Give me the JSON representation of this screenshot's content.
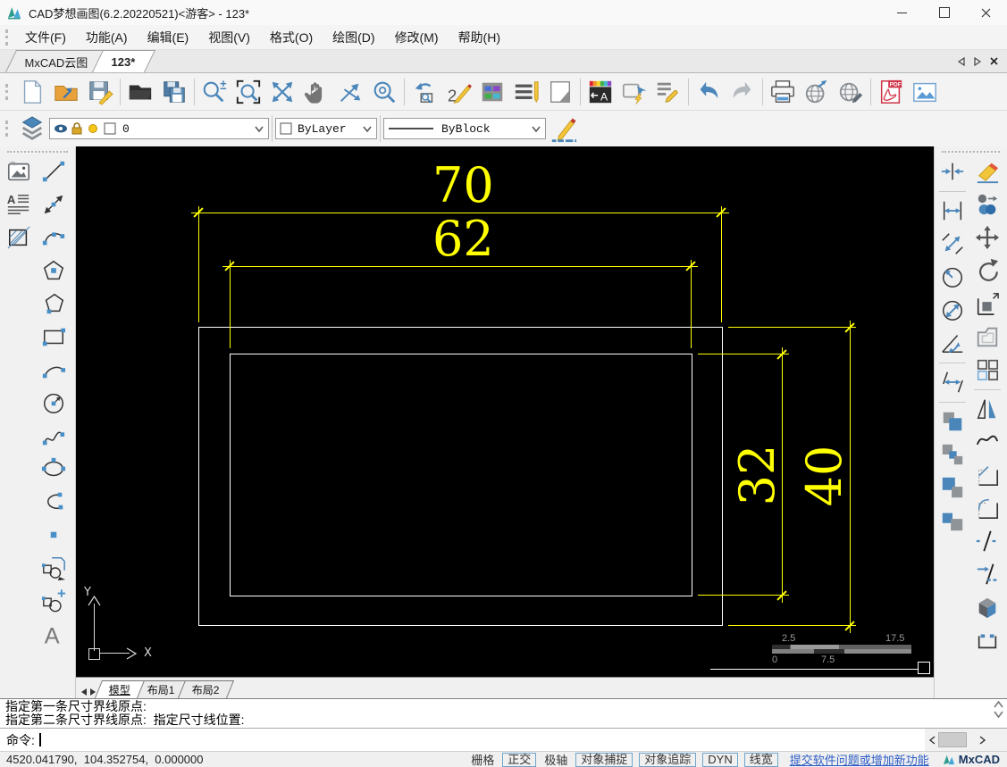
{
  "window": {
    "title": "CAD梦想画图(6.2.20220521)<游客> - 123*"
  },
  "menu": {
    "items": [
      {
        "label": "文件(F)"
      },
      {
        "label": "功能(A)"
      },
      {
        "label": "编辑(E)"
      },
      {
        "label": "视图(V)"
      },
      {
        "label": "格式(O)"
      },
      {
        "label": "绘图(D)"
      },
      {
        "label": "修改(M)"
      },
      {
        "label": "帮助(H)"
      }
    ]
  },
  "doc_tabs": {
    "tabs": [
      {
        "label": "MxCAD云图"
      },
      {
        "label": "123*"
      }
    ]
  },
  "layer_bar": {
    "layer_name": "0",
    "color_name": "ByLayer",
    "linetype_name": "ByBlock"
  },
  "canvas": {
    "dim_top_outer": "70",
    "dim_top_inner": "62",
    "dim_right_inner": "32",
    "dim_right_outer": "40",
    "ucs_x": "X",
    "ucs_y": "Y",
    "scale_top_left": "2.5",
    "scale_top_right": "17.5",
    "scale_bottom_left": "0",
    "scale_bottom_mid": "7.5"
  },
  "colors": {
    "dimension_yellow": "#ffff00",
    "drawing_white": "#ffffff",
    "canvas_black": "#000000",
    "accent_blue": "#4a86ba"
  },
  "layout_tabs": {
    "tabs": [
      {
        "label": "模型"
      },
      {
        "label": "布局1"
      },
      {
        "label": "布局2"
      }
    ]
  },
  "command": {
    "history_line_1": "指定第一条尺寸界线原点:",
    "history_line_2": "指定第二条尺寸界线原点:  指定尺寸线位置:",
    "prompt": "命令:"
  },
  "status": {
    "coordinates": "4520.041790,  104.352754,  0.000000",
    "toggles": [
      {
        "label": "栅格",
        "active": false
      },
      {
        "label": "正交",
        "active": true
      },
      {
        "label": "极轴",
        "active": false
      },
      {
        "label": "对象捕捉",
        "active": true
      },
      {
        "label": "对象追踪",
        "active": true
      },
      {
        "label": "DYN",
        "active": true
      },
      {
        "label": "线宽",
        "active": true
      }
    ],
    "link": "提交软件问题或增加新功能",
    "brand": "MxCAD"
  },
  "glyphs": {
    "letter_a": "A",
    "pdf": "PDF",
    "sketch": "2"
  }
}
